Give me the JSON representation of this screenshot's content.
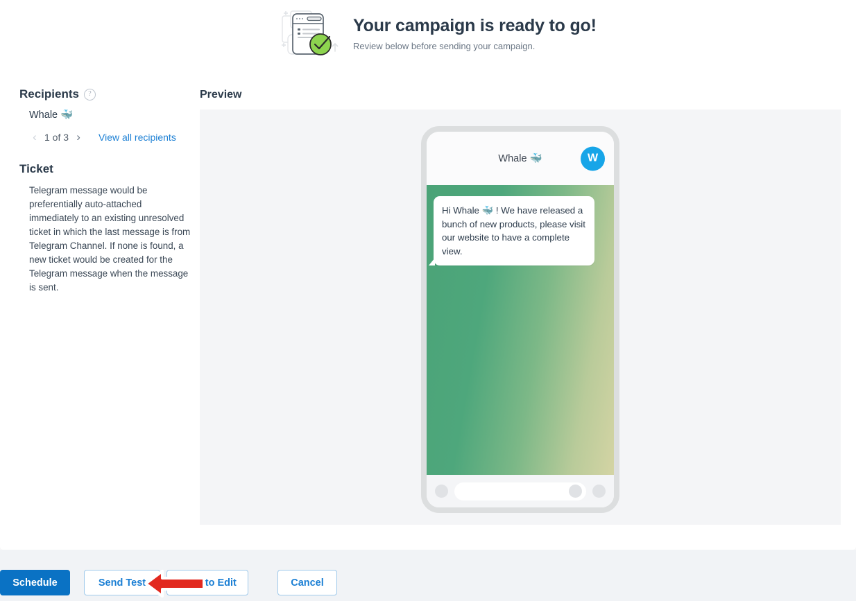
{
  "header": {
    "illustration_icon": "campaign-ready-illustration",
    "title": "Your campaign is ready to go!",
    "subtitle": "Review below before sending your campaign."
  },
  "recipients": {
    "heading": "Recipients",
    "help_icon": "question-mark-icon",
    "name": "Whale 🐳",
    "prev_icon": "chevron-left-icon",
    "next_icon": "chevron-right-icon",
    "pager_label": "1 of 3",
    "view_all_label": "View all recipients"
  },
  "ticket": {
    "heading": "Ticket",
    "description": "Telegram message would be preferentially auto-attached immediately to an existing unresolved ticket in which the last message is from Telegram Channel. If none is found, a new ticket would be created for the Telegram message when the message is sent."
  },
  "preview": {
    "heading": "Preview",
    "phone": {
      "chat_title": "Whale 🐳",
      "avatar_initial": "W",
      "avatar_color": "#17a5e8",
      "message": "Hi Whale 🐳 ! We have released a bunch of new products, please visit our website to have a complete view.",
      "footer": {
        "left_dot_icon": "circle-dot-icon",
        "input_dot_icon": "circle-dot-icon",
        "right_dot_icon": "circle-dot-icon"
      }
    }
  },
  "actions": {
    "schedule_label": "Schedule",
    "send_test_label": "Send Test",
    "back_to_edit_label": "Back to Edit",
    "cancel_label": "Cancel"
  },
  "cursor": {
    "icon": "red-left-arrow-cursor",
    "color": "#e2291f"
  },
  "colors": {
    "primary_blue": "#0a72c4",
    "link_blue": "#1b7fd4",
    "panel_gray": "#f4f5f7",
    "footer_gray": "#f1f3f6"
  }
}
